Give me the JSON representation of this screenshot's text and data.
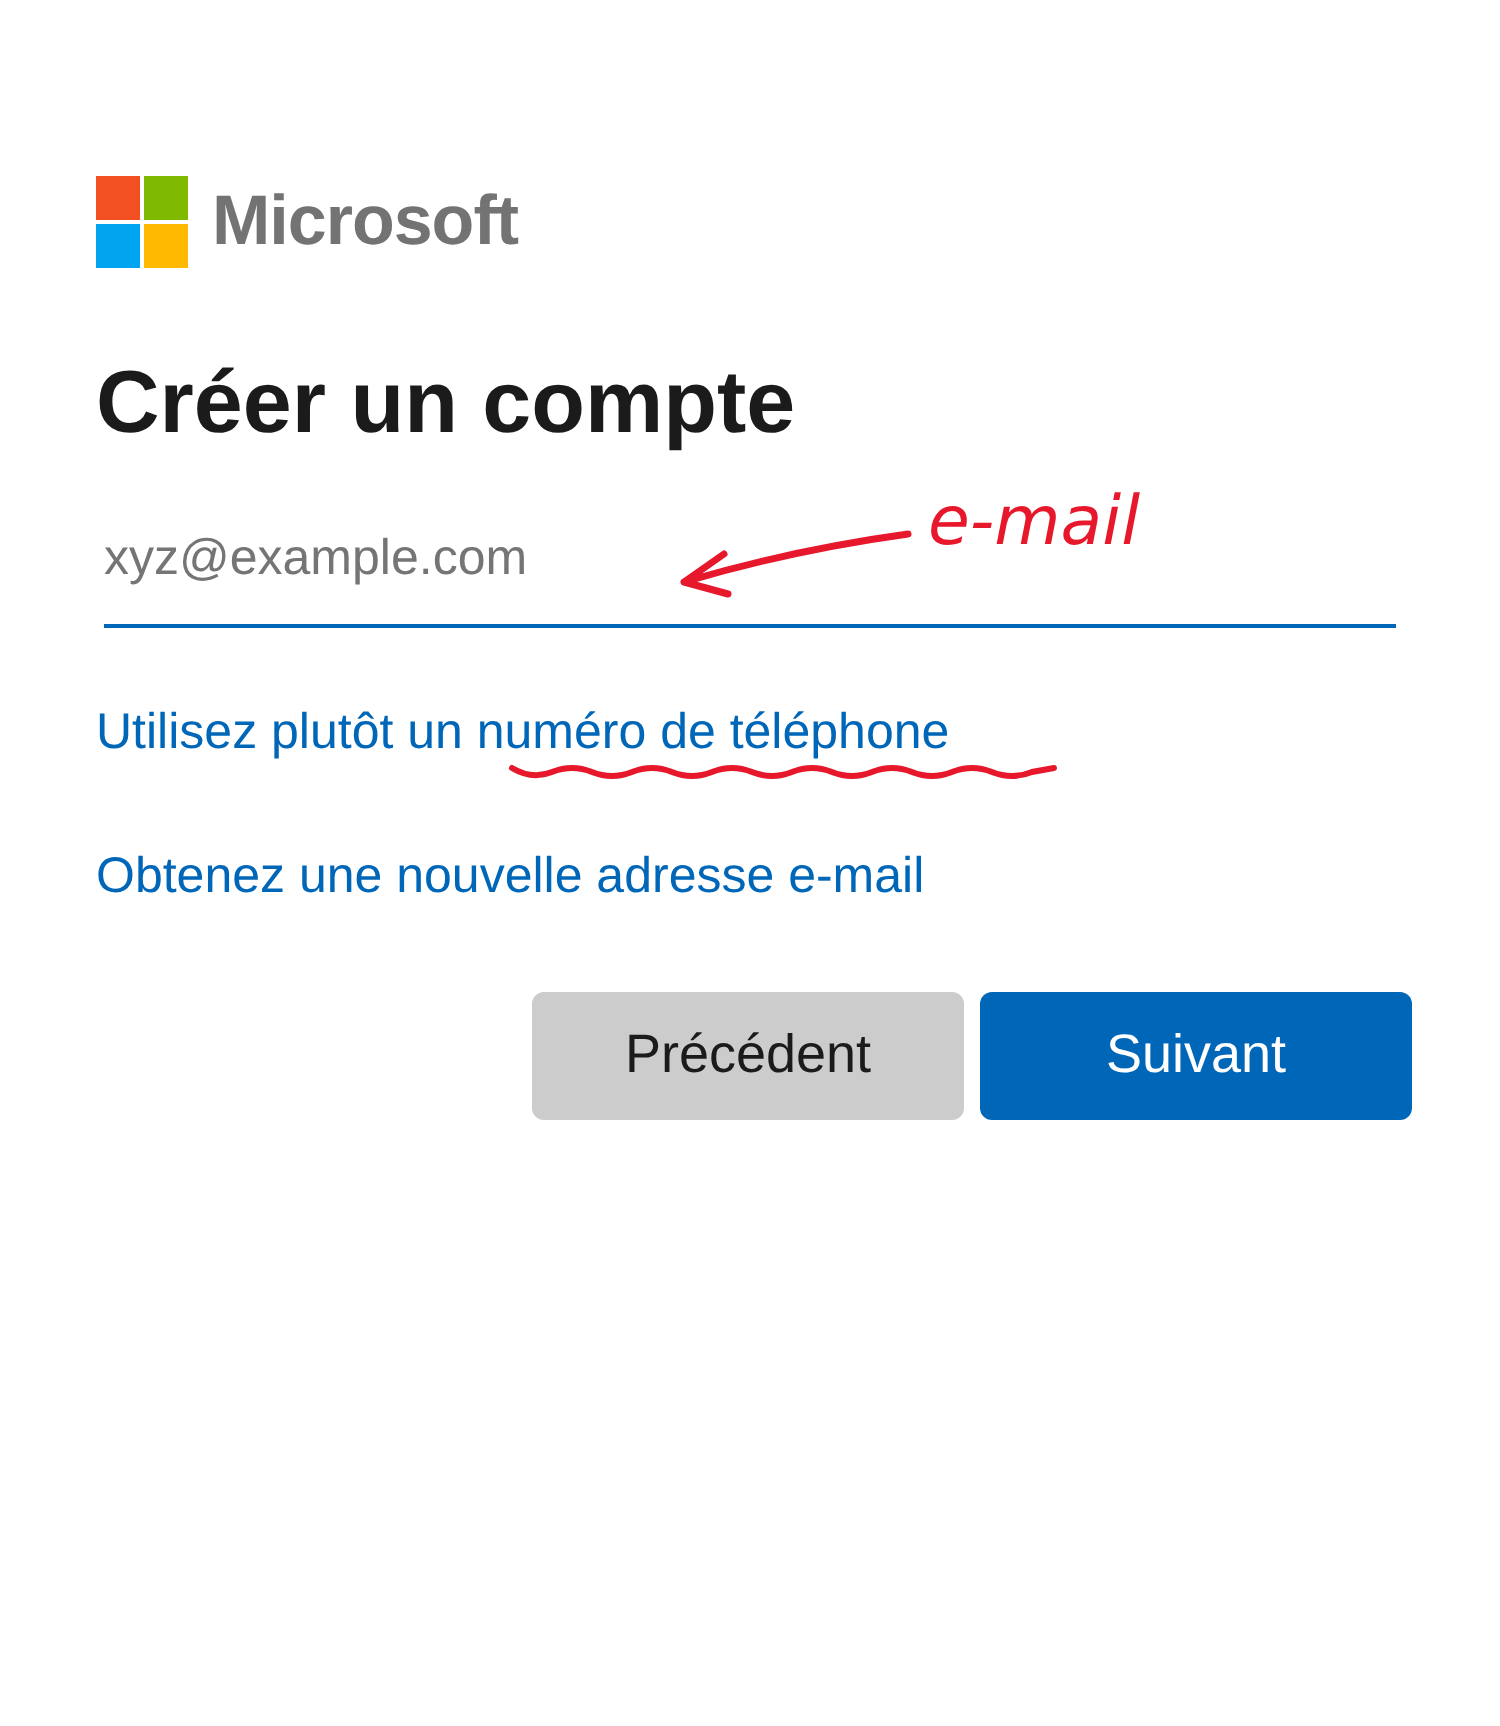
{
  "logo": {
    "text": "Microsoft"
  },
  "title": "Créer un compte",
  "email_field": {
    "placeholder": "xyz@example.com"
  },
  "links": [
    "Utilisez plutôt un numéro de téléphone",
    "Obtenez une nouvelle adresse e-mail"
  ],
  "buttons": [
    {
      "label": "Précédent",
      "kind": "secondary"
    },
    {
      "label": "Suivant",
      "kind": "primary"
    }
  ],
  "annotation": {
    "label": "e-mail"
  }
}
